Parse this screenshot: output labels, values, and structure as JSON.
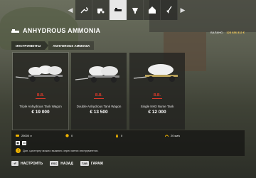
{
  "header": {
    "title": "ANHYDROUS AMMONIA"
  },
  "balance": {
    "label": "БАЛАНС:",
    "value": "123 636 312 €"
  },
  "breadcrumb": {
    "first": "ИНСТРУМЕНТЫ",
    "second": "ANHYDROUS AMMONIA"
  },
  "nav": {
    "left_arrow": "◀",
    "right_arrow": "▶"
  },
  "categories": [
    {
      "icon": "wrench-icon"
    },
    {
      "icon": "tractor-icon"
    },
    {
      "icon": "tool-icon",
      "active": true
    },
    {
      "icon": "hopper-icon"
    },
    {
      "icon": "house-icon"
    },
    {
      "icon": "shovel-icon"
    }
  ],
  "products": [
    {
      "brand": "B.B.",
      "name": "Triple Anhydrous Tank Wagon",
      "price": "€ 19 000"
    },
    {
      "brand": "B.B.",
      "name": "Double Anhydrous Tank Wagon",
      "price": "€ 13 500"
    },
    {
      "brand": "B.B.",
      "name": "Single NH3 Nurse Tank",
      "price": "€ 12 000"
    }
  ],
  "info": {
    "capacity": "25000 л",
    "cost": "0",
    "weight": "0",
    "speed": "20 км/ч",
    "note": "Доп. цистерну можно вызвать через меню инструментов."
  },
  "controls": {
    "configure_key": "⏎",
    "configure": "НАСТРОИТЬ",
    "back_key": "ESC",
    "back": "НАЗАД",
    "garage_key": "TAB",
    "garage": "ГАРАЖ"
  },
  "colors": {
    "price_balance": "#ffd15a",
    "brand": "#e23a2a",
    "accent_active": "#e7e7e7"
  }
}
